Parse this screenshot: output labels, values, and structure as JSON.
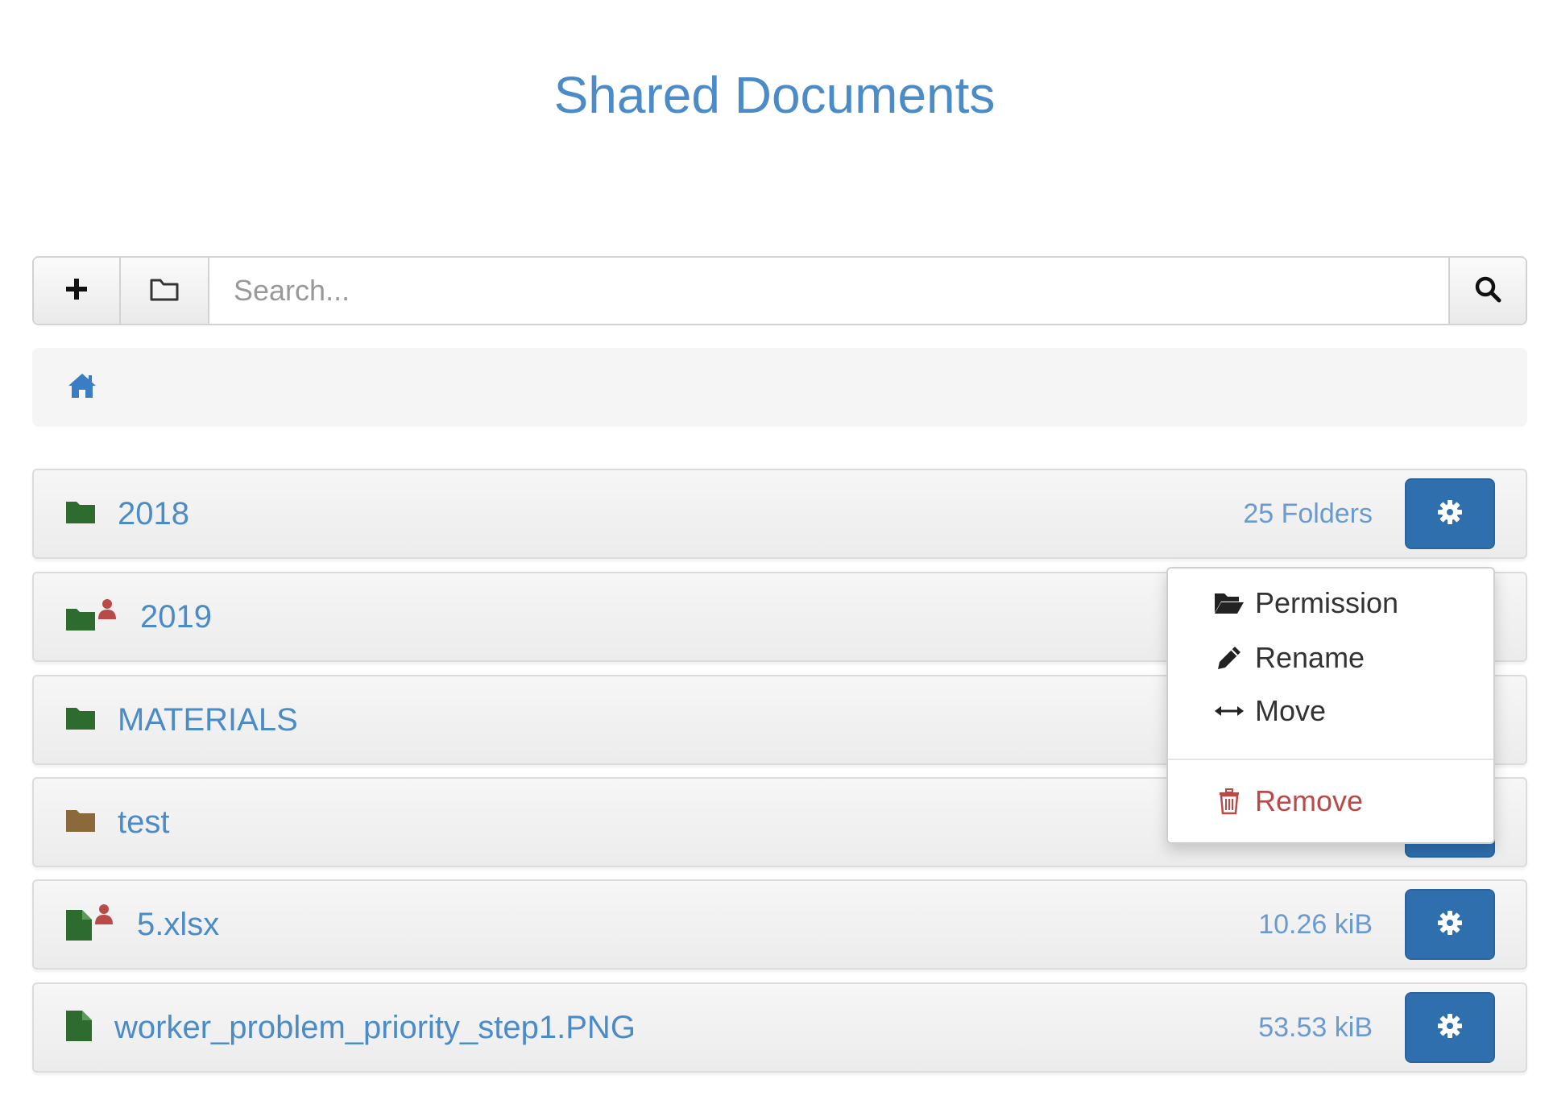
{
  "page": {
    "title": "Shared Documents"
  },
  "toolbar": {
    "add_icon": "plus-icon",
    "folder_icon": "folder-outline-icon",
    "search_placeholder": "Search...",
    "search_value": "",
    "search_icon": "search-icon"
  },
  "breadcrumb": {
    "home_icon": "home-icon"
  },
  "items": [
    {
      "name": "2018",
      "type": "folder",
      "icon": "folder-icon",
      "icon_color": "#2e6b2e",
      "shared": false,
      "meta": "25 Folders"
    },
    {
      "name": "2019",
      "type": "folder",
      "icon": "folder-icon",
      "icon_color": "#2e6b2e",
      "shared": true,
      "meta": ""
    },
    {
      "name": "MATERIALS",
      "type": "folder",
      "icon": "folder-icon",
      "icon_color": "#2e6b2e",
      "shared": false,
      "meta": ""
    },
    {
      "name": "test",
      "type": "folder",
      "icon": "folder-icon",
      "icon_color": "#8a6a3a",
      "shared": false,
      "meta": ""
    },
    {
      "name": "5.xlsx",
      "type": "file",
      "icon": "file-icon",
      "icon_color": "#2e6b2e",
      "shared": true,
      "meta": "10.26 kiB"
    },
    {
      "name": "worker_problem_priority_step1.PNG",
      "type": "file",
      "icon": "file-icon",
      "icon_color": "#2e6b2e",
      "shared": false,
      "meta": "53.53 kiB"
    }
  ],
  "dropdown": {
    "items": [
      {
        "label": "Permission",
        "icon": "folder-open-icon"
      },
      {
        "label": "Rename",
        "icon": "pencil-icon"
      },
      {
        "label": "Move",
        "icon": "arrows-horizontal-icon"
      }
    ],
    "danger_item": {
      "label": "Remove",
      "icon": "trash-icon"
    }
  },
  "colors": {
    "accent": "#4a8bc8",
    "button": "#2f6fae",
    "danger": "#b94a48",
    "shared_user": "#b94a48"
  }
}
